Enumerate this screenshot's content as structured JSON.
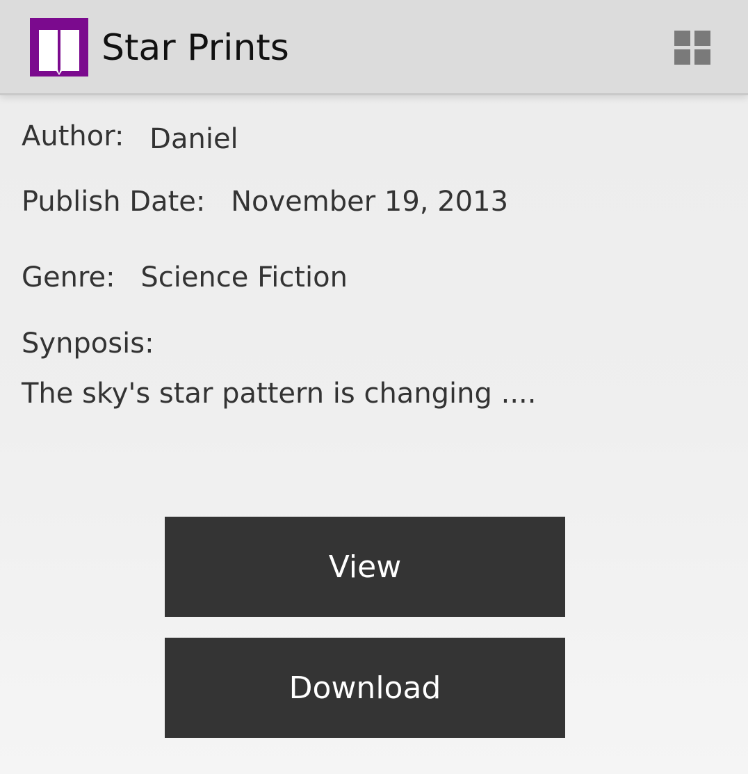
{
  "app": {
    "title": "Star Prints",
    "icon": "book-icon",
    "icon_bg": "#7b0a8e"
  },
  "toolbar": {
    "grid_icon": "grid-view-icon"
  },
  "book": {
    "author_label": "Author:",
    "author": "Daniel",
    "publish_date_label": "Publish Date:",
    "publish_date": "November 19, 2013",
    "genre_label": "Genre:",
    "genre": "Science Fiction",
    "synopsis_label": "Synposis:",
    "synopsis": "The sky's star pattern is changing ...."
  },
  "actions": {
    "view_label": "View",
    "download_label": "Download",
    "button_bg": "#343434"
  }
}
